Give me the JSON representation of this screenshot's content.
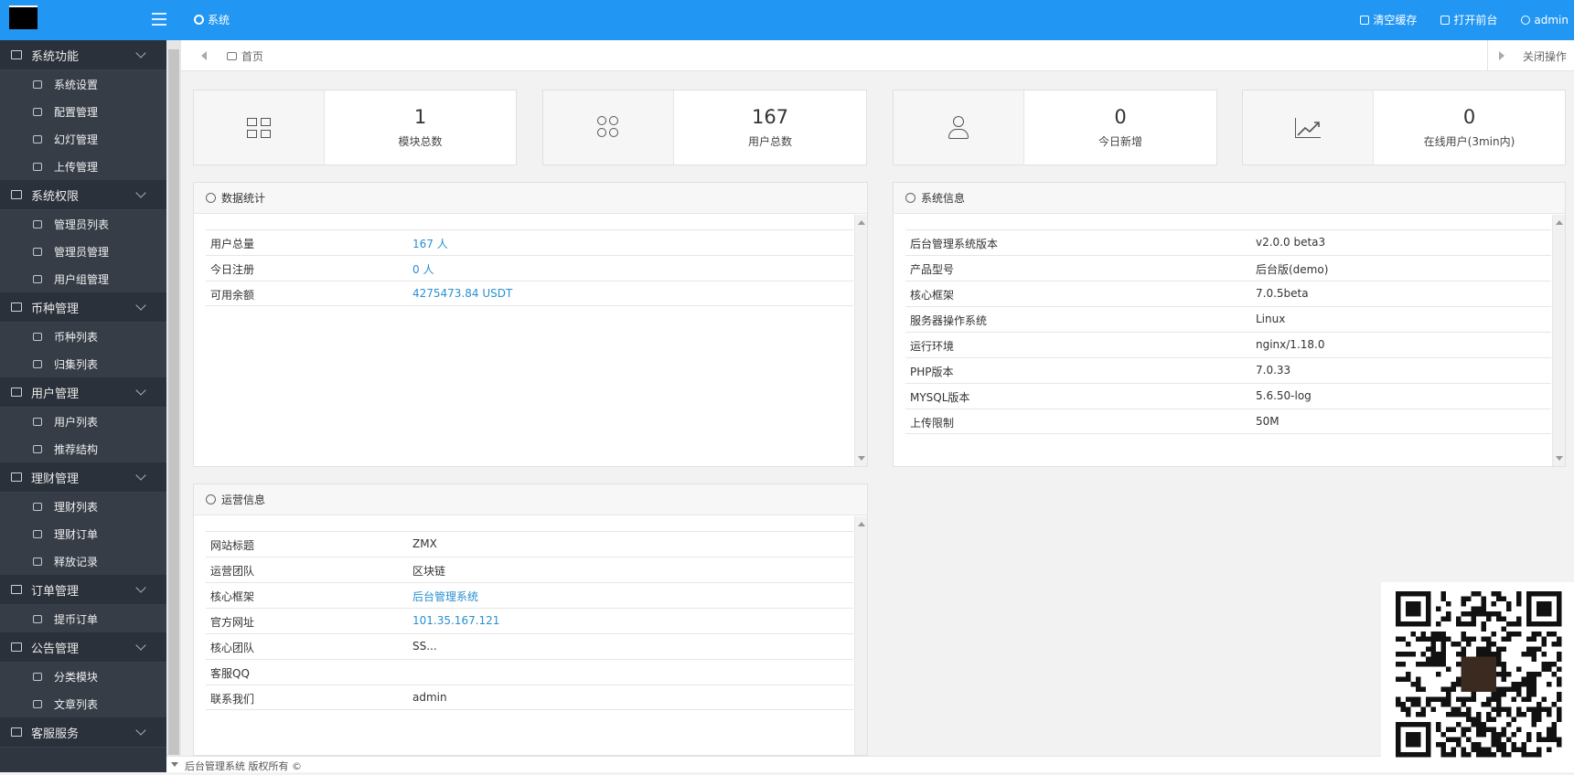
{
  "header": {
    "system_label": "系统",
    "clear_cache": "清空缓存",
    "open_frontend": "打开前台",
    "user": "admin"
  },
  "tabs": {
    "home": "首页",
    "close_ops": "关闭操作"
  },
  "sidebar": {
    "groups": [
      {
        "label": "系统功能",
        "items": [
          "系统设置",
          "配置管理",
          "幻灯管理",
          "上传管理"
        ]
      },
      {
        "label": "系统权限",
        "items": [
          "管理员列表",
          "管理员管理",
          "用户组管理"
        ]
      },
      {
        "label": "币种管理",
        "items": [
          "币种列表",
          "归集列表"
        ]
      },
      {
        "label": "用户管理",
        "items": [
          "用户列表",
          "推荐结构"
        ]
      },
      {
        "label": "理财管理",
        "items": [
          "理财列表",
          "理财订单",
          "释放记录"
        ]
      },
      {
        "label": "订单管理",
        "items": [
          "提币订单"
        ]
      },
      {
        "label": "公告管理",
        "items": [
          "分类模块",
          "文章列表"
        ]
      },
      {
        "label": "客服服务",
        "items": []
      }
    ]
  },
  "stats": [
    {
      "value": "1",
      "label": "模块总数",
      "icon": "grid-icon"
    },
    {
      "value": "167",
      "label": "用户总数",
      "icon": "users-icon"
    },
    {
      "value": "0",
      "label": "今日新增",
      "icon": "user-icon"
    },
    {
      "value": "0",
      "label": "在线用户(3min内)",
      "icon": "trend-icon"
    }
  ],
  "data_stats": {
    "title": "数据统计",
    "rows": [
      {
        "key": "用户总量",
        "value": "167 人"
      },
      {
        "key": "今日注册",
        "value": "0 人"
      },
      {
        "key": "可用余额",
        "value": "4275473.84 USDT"
      }
    ]
  },
  "system_info": {
    "title": "系统信息",
    "rows": [
      {
        "key": "后台管理系统版本",
        "value": "v2.0.0 beta3"
      },
      {
        "key": "产品型号",
        "value": "后台版(demo)"
      },
      {
        "key": "核心框架",
        "value": "7.0.5beta"
      },
      {
        "key": "服务器操作系统",
        "value": "Linux"
      },
      {
        "key": "运行环境",
        "value": "nginx/1.18.0"
      },
      {
        "key": "PHP版本",
        "value": "7.0.33"
      },
      {
        "key": "MYSQL版本",
        "value": "5.6.50-log"
      },
      {
        "key": "上传限制",
        "value": "50M"
      }
    ]
  },
  "ops_info": {
    "title": "运营信息",
    "rows": [
      {
        "key": "网站标题",
        "value": "ZMX"
      },
      {
        "key": "运营团队",
        "value": "区块链"
      },
      {
        "key": "核心框架",
        "value": "后台管理系统"
      },
      {
        "key": "官方网址",
        "value": "101.35.167.121"
      },
      {
        "key": "核心团队",
        "value": "SS..."
      },
      {
        "key": "客服QQ",
        "value": ""
      },
      {
        "key": "联系我们",
        "value": "admin"
      }
    ]
  },
  "footer": {
    "text": "后台管理系统 版权所有 ©"
  },
  "colors": {
    "accent": "#2196f3",
    "sidebar": "#2f3640",
    "link": "#2a8fd0"
  }
}
